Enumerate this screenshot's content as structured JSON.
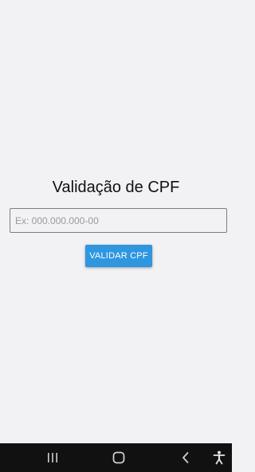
{
  "app": {
    "title": "Validação de CPF"
  },
  "form": {
    "cpf_placeholder": "Ex: 000.000.000-00",
    "cpf_value": "",
    "validate_label": "VALIDAR CPF"
  },
  "colors": {
    "background": "#f2f1f4",
    "accent": "#2f96e0",
    "nav_bar": "#111111"
  },
  "nav_bar": {
    "icons": [
      "recent-apps-icon",
      "home-icon",
      "back-icon",
      "accessibility-icon"
    ]
  }
}
